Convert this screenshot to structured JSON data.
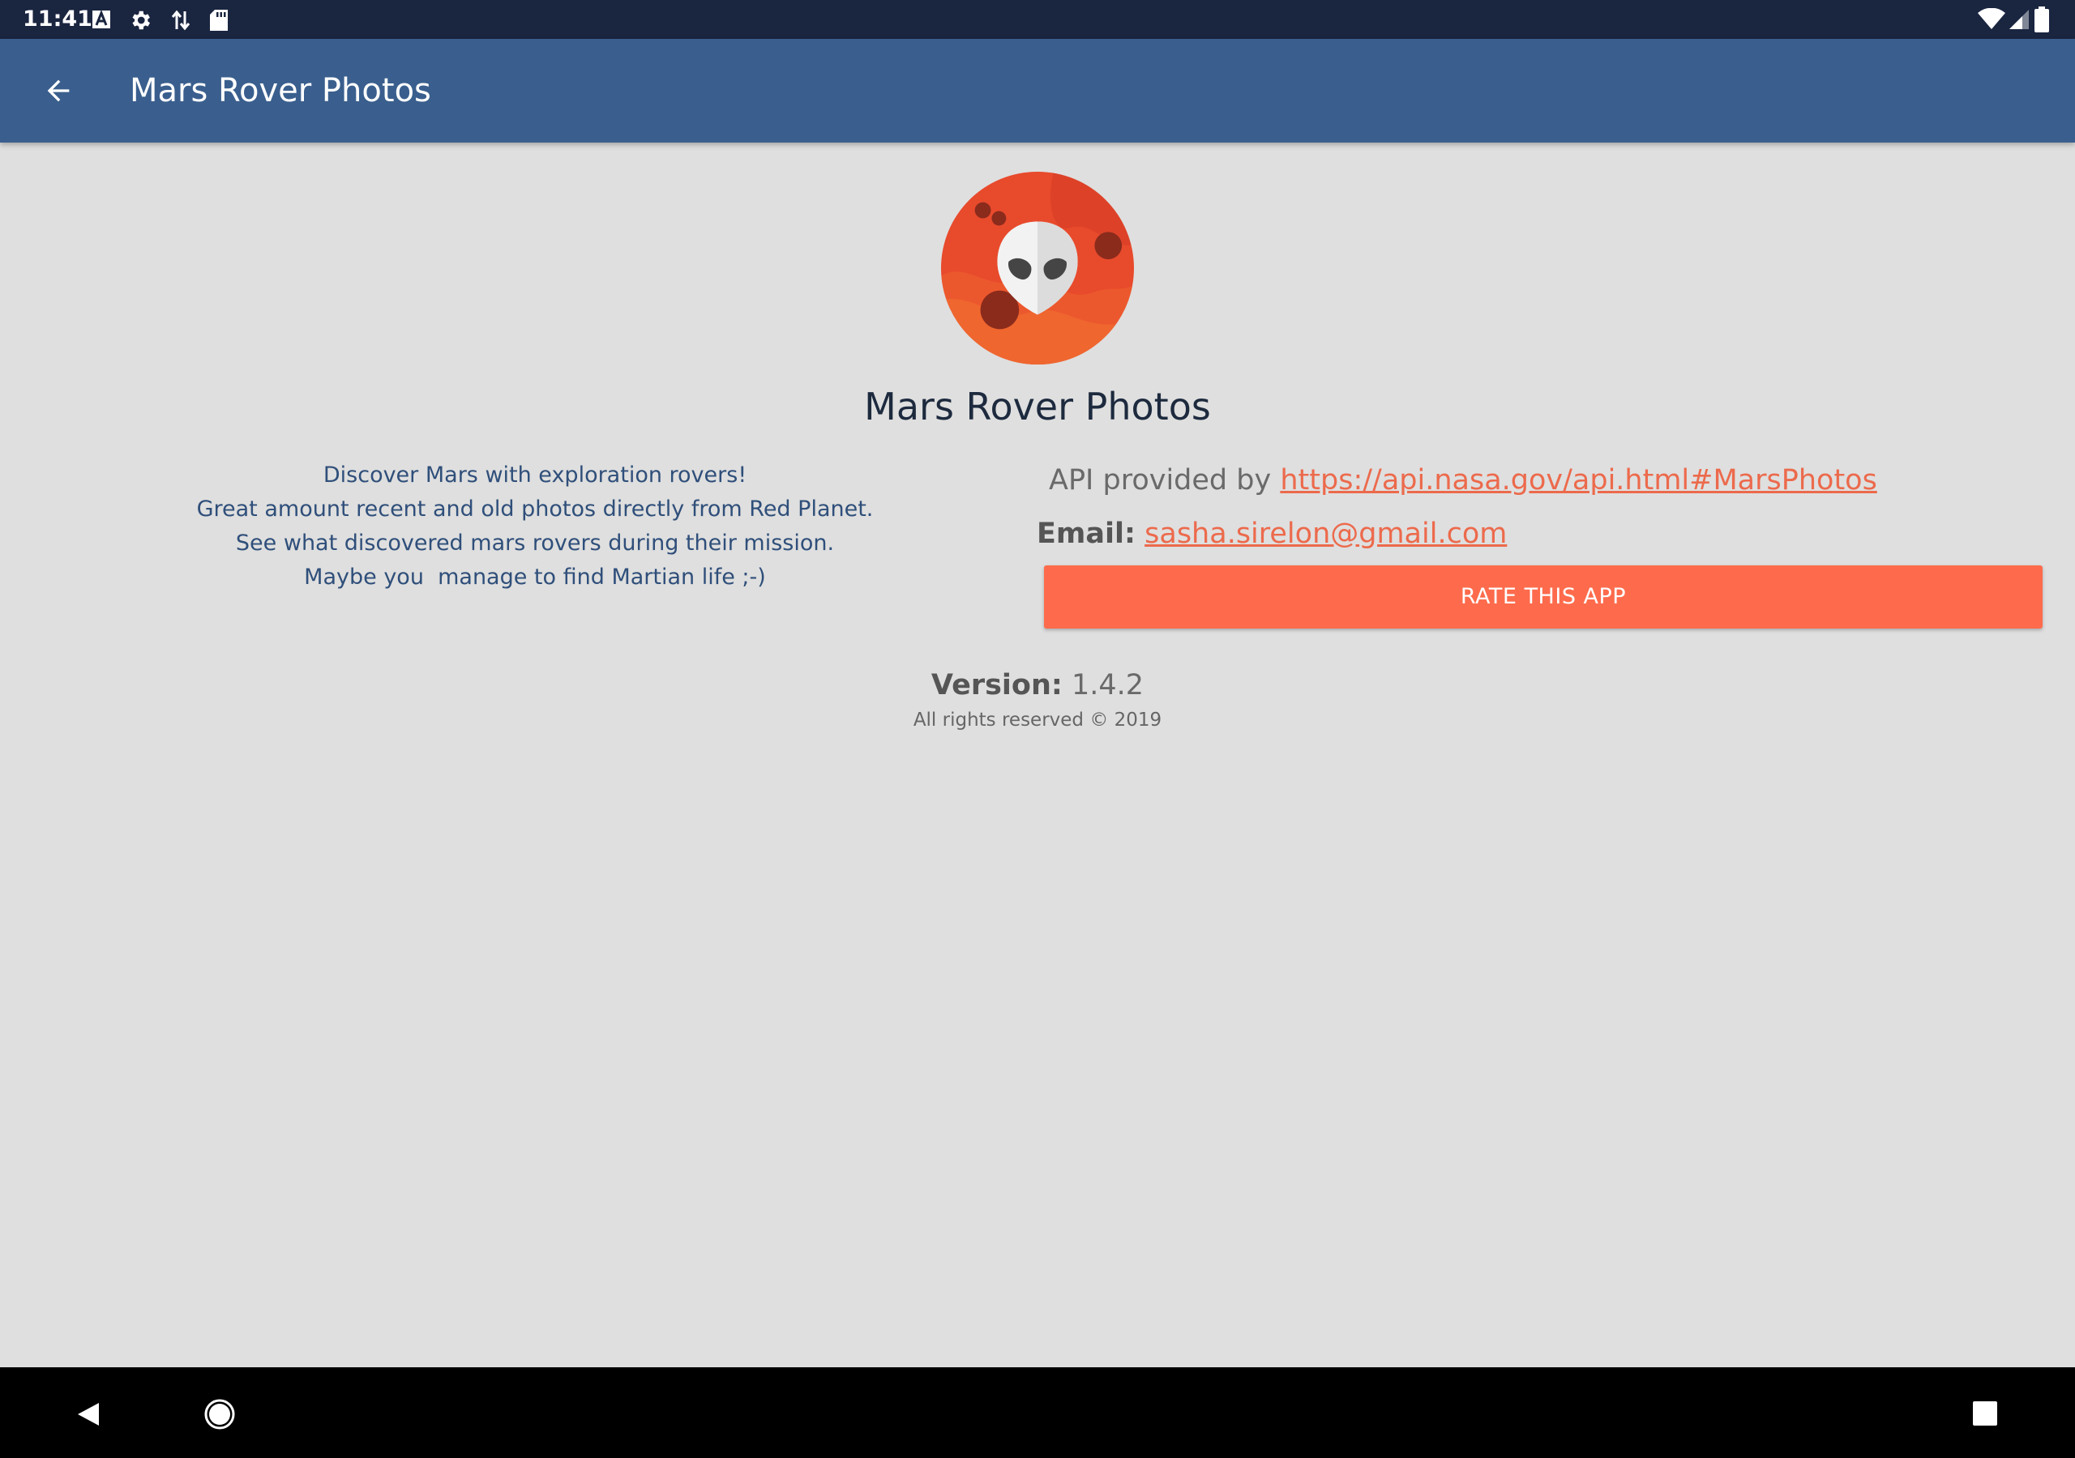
{
  "status_bar": {
    "time": "11:41",
    "left_icons": [
      "text-a-icon",
      "gear-icon",
      "data-transfer-icon",
      "sd-card-icon"
    ],
    "right_icons": [
      "wifi-icon",
      "signal-icon",
      "battery-icon"
    ]
  },
  "app_bar": {
    "title": "Mars Rover Photos",
    "back_icon": "arrow-back-icon",
    "color": "#3a5f8e"
  },
  "about": {
    "app_name": "Mars Rover Photos",
    "description": [
      "Discover Mars with exploration rovers!",
      "Great amount recent and old photos directly from Red Planet.",
      "See what discovered mars rovers during their mission.",
      "Maybe you  manage to find Martian life ;-)"
    ],
    "api_prefix": "API provided by",
    "api_link": "https://api.nasa.gov/api.html#MarsPhotos",
    "email_label": "Email:",
    "email": "sasha.sirelon@gmail.com",
    "rate_button": "RATE THIS APP",
    "version_label": "Version:",
    "version": "1.4.2",
    "rights": "All rights reserved © 2019",
    "accent_color": "#fd6b4c",
    "link_color": "#ec6a4c"
  },
  "nav_bar": {
    "buttons": [
      "back-triangle-icon",
      "home-circle-icon",
      "recents-square-icon"
    ]
  }
}
